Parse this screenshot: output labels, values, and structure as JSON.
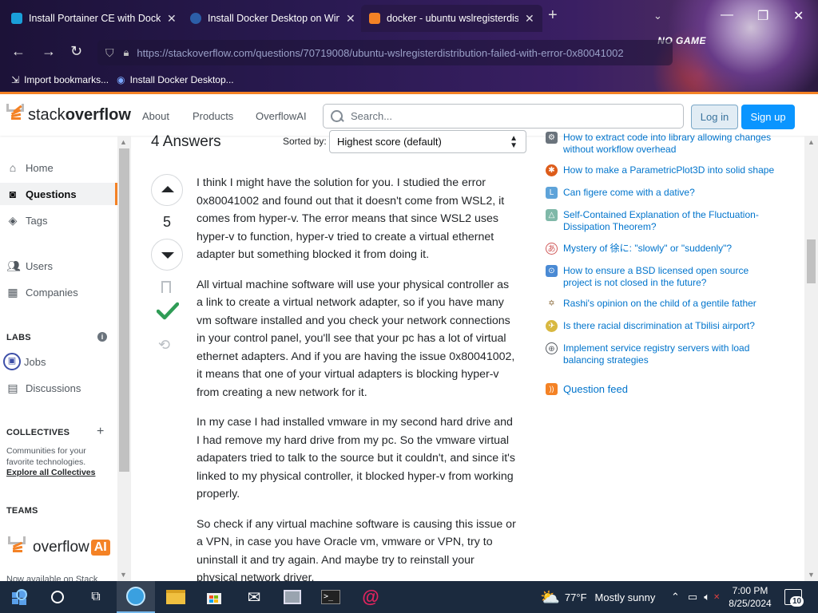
{
  "browser": {
    "tabs": [
      {
        "title": "Install Portainer CE with Dock",
        "icon_color": "#1a9fd9"
      },
      {
        "title": "Install Docker Desktop on Wind",
        "icon_color": "#2c5ea8"
      },
      {
        "title": "docker - ubuntu wslregisterdist",
        "icon_color": "#f48225"
      }
    ],
    "url": "https://stackoverflow.com/questions/70719008/ubuntu-wslregisterdistribution-failed-with-error-0x80041002",
    "bookmarks": [
      {
        "label": "Import bookmarks...",
        "icon": "import-icon"
      },
      {
        "label": "Install Docker Desktop...",
        "icon": "docker-icon"
      }
    ],
    "theme_text": "NO GAME"
  },
  "topbar": {
    "logo_light": "stack",
    "logo_bold": "overflow",
    "nav": [
      "About",
      "Products",
      "OverflowAI"
    ],
    "search_placeholder": "Search...",
    "login_label": "Log in",
    "signup_label": "Sign up"
  },
  "sidebar": {
    "items": [
      {
        "label": "Home",
        "icon": "home-icon"
      },
      {
        "label": "Questions",
        "icon": "questions-icon"
      },
      {
        "label": "Tags",
        "icon": "tag-icon"
      },
      {
        "label": "Users",
        "icon": "users-icon"
      },
      {
        "label": "Companies",
        "icon": "companies-icon"
      }
    ],
    "labs_heading": "LABS",
    "labs_items": [
      {
        "label": "Jobs",
        "icon": "jobs-icon"
      },
      {
        "label": "Discussions",
        "icon": "discussions-icon"
      }
    ],
    "collectives_heading": "COLLECTIVES",
    "collectives_text": "Communities for your favorite technologies.",
    "collectives_link": "Explore all Collectives",
    "teams_heading": "TEAMS",
    "overflow_ai_text": "overflow",
    "overflow_ai_badge": "AI",
    "cut_text": "Now available on Stack"
  },
  "answers": {
    "count_label": "4 Answers",
    "sorted_label": "Sorted by:",
    "sort_value": "Highest score (default)",
    "vote_count": "5",
    "paragraphs": [
      "I think I might have the solution for you. I studied the error 0x80041002 and found out that it doesn't come from WSL2, it comes from hyper-v. The error means that since WSL2 uses hyper-v to function, hyper-v tried to create a virtual ethernet adapter but something blocked it from doing it.",
      "All virtual machine software will use your physical controller as a link to create a virtual network adapter, so if you have many vm software installed and you check your network connections in your control panel, you'll see that your pc has a lot of virtual ethernet adapters. And if you are having the issue 0x80041002, it means that one of your virtual adapters is blocking hyper-v from creating a new network for it.",
      "In my case I had installed vmware in my second hard drive and I had remove my hard drive from my pc. So the vmware virtual adapaters tried to talk to the source but it couldn't, and since it's linked to my physical controller, it blocked hyper-v from working properly.",
      "So check if any virtual machine software is causing this issue or a VPN, in case you have Oracle vm, vmware or VPN, try to uninstall it and try again. And maybe try to reinstall your physical network driver."
    ]
  },
  "hot_questions": [
    {
      "title": "How to extract code into library allowing changes without workflow overhead",
      "icon_color": "#6a737c"
    },
    {
      "title": "How to make a ParametricPlot3D into solid shape",
      "icon_color": "#dd5c1a"
    },
    {
      "title": "Can figere come with a dative?",
      "icon_color": "#5ea3d9"
    },
    {
      "title": "Self-Contained Explanation of the Fluctuation-Dissipation Theorem?",
      "icon_color": "#7fb8a8"
    },
    {
      "title": "Mystery of 徐に: \"slowly\" or \"suddenly\"?",
      "icon_color": "#d05a5a"
    },
    {
      "title": "How to ensure a BSD licensed open source project is not closed in the future?",
      "icon_color": "#4a8ad4"
    },
    {
      "title": "Rashi's opinion on the child of a gentile father",
      "icon_color": "#8a6a3a"
    },
    {
      "title": "Is there racial discrimination at Tbilisi airport?",
      "icon_color": "#d8b840"
    },
    {
      "title": "Implement service registry servers with load balancing strategies",
      "icon_color": "#555a60"
    }
  ],
  "question_feed_label": "Question feed",
  "taskbar": {
    "weather_temp": "77°F",
    "weather_text": "Mostly sunny",
    "time": "7:00 PM",
    "date": "8/25/2024",
    "notification_count": "10"
  }
}
